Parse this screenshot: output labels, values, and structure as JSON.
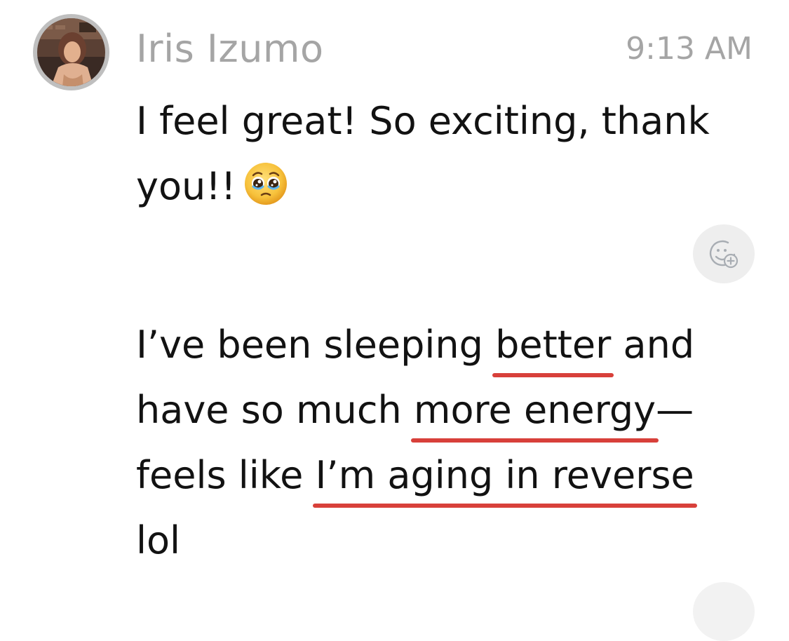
{
  "message_header": {
    "sender_name": "Iris Izumo",
    "timestamp": "9:13 AM",
    "avatar_icon": "profile-photo"
  },
  "messages": [
    {
      "lines": [
        {
          "segments": [
            {
              "text": "I feel great! So exciting, thank",
              "underlined": false
            }
          ]
        },
        {
          "segments": [
            {
              "text": "you!!",
              "underlined": false
            }
          ],
          "emoji": "pleading-face-emoji"
        }
      ]
    },
    {
      "lines": [
        {
          "segments": [
            {
              "text": "I’ve been sleeping ",
              "underlined": false
            },
            {
              "text": "better",
              "underlined": true
            },
            {
              "text": " and",
              "underlined": false
            }
          ]
        },
        {
          "segments": [
            {
              "text": "have so much ",
              "underlined": false
            },
            {
              "text": "more energy",
              "underlined": true
            },
            {
              "text": "—",
              "underlined": false
            }
          ]
        },
        {
          "segments": [
            {
              "text": "feels like ",
              "underlined": false
            },
            {
              "text": "I’m aging in reverse",
              "underlined": true
            }
          ]
        },
        {
          "segments": [
            {
              "text": "lol",
              "underlined": false
            }
          ]
        }
      ]
    }
  ],
  "reaction_button": {
    "icon": "add-reaction-icon"
  },
  "colors": {
    "name_gray": "#a5a5a5",
    "text": "#121212",
    "underline_red": "#d8403a",
    "reaction_bg": "#eeeeee"
  }
}
